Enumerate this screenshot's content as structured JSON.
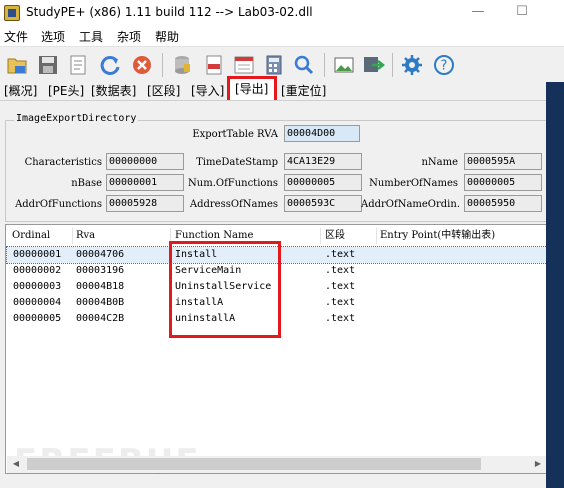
{
  "window": {
    "title": "StudyPE+ (x86) 1.11 build 112  --> Lab03-02.dll"
  },
  "menu": [
    "文件",
    "选项",
    "工具",
    "杂项",
    "帮助"
  ],
  "toolbar_icons": [
    "open-folder-icon",
    "save-icon",
    "document-icon",
    "refresh-icon",
    "stop-icon",
    "database-icon",
    "asm-file-icon",
    "hex-file-icon",
    "calculator-icon",
    "search-icon",
    "image-icon",
    "export-icon",
    "gear-icon",
    "help-icon"
  ],
  "tabs": [
    "[概况]",
    "[PE头]",
    "[数据表]",
    "[区段]",
    "[导入]",
    "[导出]",
    "[重定位]"
  ],
  "active_tab": "[导出]",
  "group_title": "ImageExportDirectory",
  "fields": {
    "export_table_rva": {
      "label": "ExportTable RVA",
      "value": "00004D00"
    },
    "characteristics": {
      "label": "Characteristics",
      "value": "00000000"
    },
    "time_date_stamp": {
      "label": "TimeDateStamp",
      "value": "4CA13E29"
    },
    "name": {
      "label": "nName",
      "value": "0000595A"
    },
    "base": {
      "label": "nBase",
      "value": "00000001"
    },
    "num_of_functions": {
      "label": "Num.OfFunctions",
      "value": "00000005"
    },
    "number_of_names": {
      "label": "NumberOfNames",
      "value": "00000005"
    },
    "addr_of_functions": {
      "label": "AddrOfFunctions",
      "value": "00005928"
    },
    "address_of_names": {
      "label": "AddressOfNames",
      "value": "0000593C"
    },
    "addr_of_name_ordinals": {
      "label": "AddrOfNameOrdin.",
      "value": "00005950"
    }
  },
  "table": {
    "columns": [
      "Ordinal",
      "Rva",
      "Function Name",
      "区段",
      "Entry Point(中转输出表)"
    ],
    "rows": [
      {
        "ordinal": "00000001",
        "rva": "00004706",
        "name": "Install",
        "section": ".text",
        "entry": ""
      },
      {
        "ordinal": "00000002",
        "rva": "00003196",
        "name": "ServiceMain",
        "section": ".text",
        "entry": ""
      },
      {
        "ordinal": "00000003",
        "rva": "00004B18",
        "name": "UninstallService",
        "section": ".text",
        "entry": ""
      },
      {
        "ordinal": "00000004",
        "rva": "00004B0B",
        "name": "installA",
        "section": ".text",
        "entry": ""
      },
      {
        "ordinal": "00000005",
        "rva": "00004C2B",
        "name": "uninstallA",
        "section": ".text",
        "entry": ""
      }
    ],
    "selected_row": 0
  },
  "colors": {
    "highlight_box": "#e4191b",
    "selected_row": "#e3eefb",
    "side_strip": "#15315a"
  }
}
